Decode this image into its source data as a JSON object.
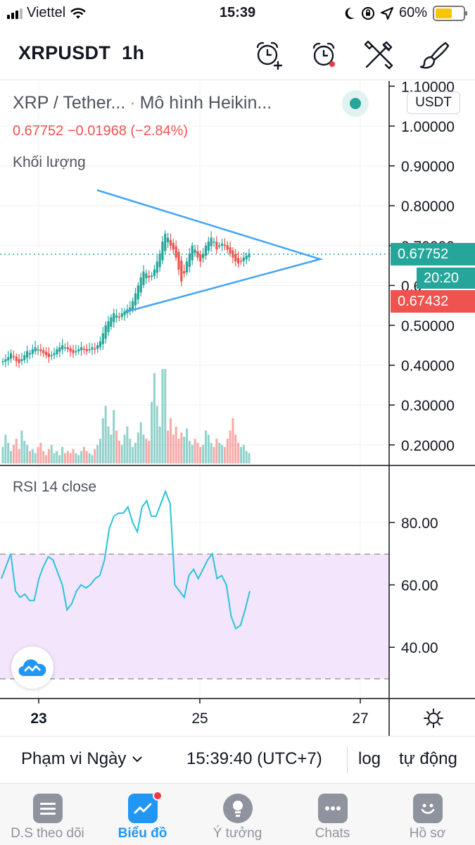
{
  "status_bar": {
    "carrier": "Viettel",
    "time": "15:39",
    "battery": "60%"
  },
  "header": {
    "symbol": "XRPUSDT",
    "interval": "1h"
  },
  "chart": {
    "title": "XRP / Tether...",
    "style": "Mô hình Heikin...",
    "ohlc_text": "0.67752  −0.01968 (−2.84%)",
    "volume_label": "Khối lượng",
    "currency": "USDT",
    "price_tag": "0.67752",
    "countdown": "20:20",
    "prev_close_tag": "0.67432",
    "rsi_label": "RSI 14 close"
  },
  "chart_data": {
    "type": "line",
    "price_axis_ticks": [
      "1.10000",
      "1.00000",
      "0.90000",
      "0.80000",
      "0.70000",
      "0.6",
      "0.50000",
      "0.40000",
      "0.30000",
      "0.20000"
    ],
    "rsi_axis_ticks": [
      "80.00",
      "60.00",
      "40.00"
    ],
    "time_axis_ticks": [
      "23",
      "25",
      "27"
    ],
    "last_price": 0.67752,
    "change": -0.01968,
    "change_percent": -2.84,
    "rsi_band": [
      30,
      70
    ],
    "close_series": [
      0.41,
      0.415,
      0.42,
      0.43,
      0.42,
      0.41,
      0.405,
      0.415,
      0.425,
      0.435,
      0.43,
      0.44,
      0.445,
      0.44,
      0.435,
      0.43,
      0.425,
      0.42,
      0.425,
      0.43,
      0.44,
      0.445,
      0.45,
      0.445,
      0.44,
      0.435,
      0.43,
      0.435,
      0.44,
      0.445,
      0.44,
      0.435,
      0.44,
      0.445,
      0.44,
      0.45,
      0.46,
      0.48,
      0.5,
      0.51,
      0.52,
      0.53,
      0.525,
      0.52,
      0.53,
      0.535,
      0.54,
      0.545,
      0.56,
      0.58,
      0.6,
      0.62,
      0.635,
      0.63,
      0.62,
      0.625,
      0.64,
      0.66,
      0.68,
      0.71,
      0.73,
      0.72,
      0.7,
      0.69,
      0.67,
      0.64,
      0.61,
      0.63,
      0.66,
      0.68,
      0.7,
      0.69,
      0.67,
      0.66,
      0.68,
      0.7,
      0.71,
      0.72,
      0.71,
      0.69,
      0.7,
      0.705,
      0.7,
      0.69,
      0.68,
      0.67,
      0.66,
      0.655,
      0.66,
      0.67,
      0.675,
      0.68
    ],
    "volume_series": [
      8,
      14,
      10,
      6,
      9,
      12,
      7,
      16,
      11,
      9,
      6,
      7,
      5,
      8,
      10,
      6,
      4,
      7,
      9,
      5,
      6,
      4,
      8,
      5,
      6,
      5,
      7,
      5,
      4,
      6,
      8,
      6,
      5,
      4,
      7,
      9,
      12,
      22,
      28,
      18,
      14,
      26,
      16,
      11,
      9,
      14,
      18,
      12,
      8,
      10,
      15,
      20,
      14,
      12,
      11,
      30,
      44,
      28,
      18,
      46,
      46,
      16,
      22,
      14,
      18,
      12,
      15,
      13,
      17,
      11,
      9,
      12,
      10,
      8,
      9,
      16,
      14,
      10,
      8,
      12,
      10,
      9,
      8,
      12,
      16,
      22,
      14,
      10,
      8,
      9,
      6,
      5
    ],
    "rsi_series": [
      62,
      66,
      70,
      58,
      56,
      57,
      55,
      55,
      62,
      66,
      69,
      68,
      64,
      60,
      52,
      54,
      58,
      60,
      59,
      60,
      62,
      63,
      68,
      78,
      82,
      83,
      83,
      85,
      80,
      77,
      85,
      87,
      82,
      82,
      86,
      90,
      86,
      60,
      58,
      56,
      63,
      65,
      62,
      65,
      68,
      70,
      62,
      63,
      60,
      50,
      46,
      47,
      52,
      58
    ]
  },
  "range_bar": {
    "range": "Phạm vi Ngày",
    "time": "15:39:40 (UTC+7)",
    "log": "log",
    "auto": "tự động"
  },
  "tabs": [
    {
      "label": "D.S theo dõi",
      "icon": "watchlist-icon"
    },
    {
      "label": "Biểu đồ",
      "icon": "chart-icon"
    },
    {
      "label": "Ý tưởng",
      "icon": "ideas-icon"
    },
    {
      "label": "Chats",
      "icon": "chats-icon"
    },
    {
      "label": "Hồ sơ",
      "icon": "profile-icon"
    }
  ],
  "colors": {
    "bull": "#26a69a",
    "bear": "#ef5350",
    "accent": "#2196f3",
    "rsi": "#2bc4d8",
    "rsi_band": "#f3e5fc"
  }
}
